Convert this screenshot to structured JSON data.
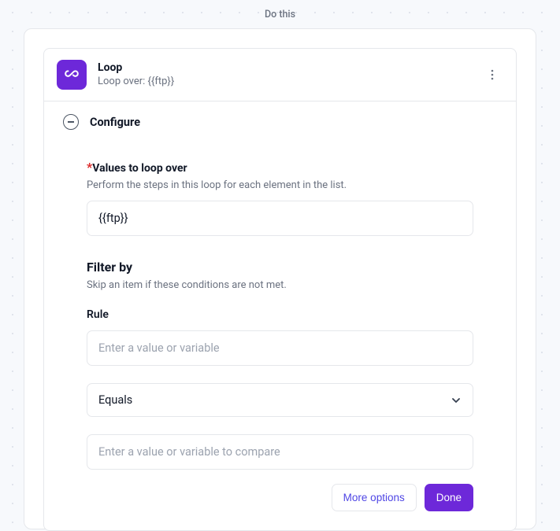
{
  "page": {
    "top_label": "Do this"
  },
  "node": {
    "title": "Loop",
    "subtitle": "Loop over: {{ftp}}"
  },
  "configure": {
    "title": "Configure",
    "values_label": "Values to loop over",
    "values_help": "Perform the steps in this loop for each element in the list.",
    "values_value": "{{ftp}}",
    "filter_title": "Filter by",
    "filter_help": "Skip an item if these conditions are not met.",
    "rule_label": "Rule",
    "rule_value_placeholder": "Enter a value or variable",
    "operator_selected": "Equals",
    "compare_placeholder": "Enter a value or variable to compare"
  },
  "actions": {
    "more": "More options",
    "done": "Done"
  }
}
